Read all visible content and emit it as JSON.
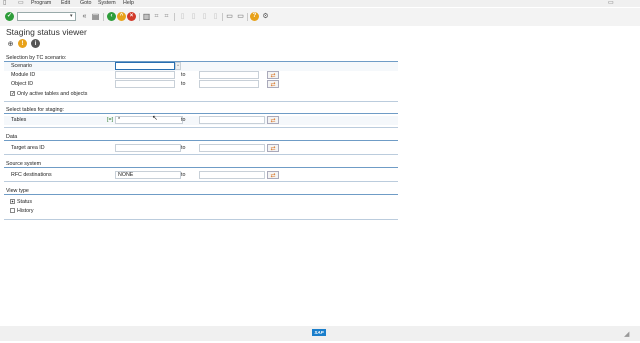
{
  "menu": {
    "items": [
      {
        "label": "Program",
        "name": "menu-program"
      },
      {
        "label": "Edit",
        "name": "menu-edit"
      },
      {
        "label": "Goto",
        "name": "menu-goto"
      },
      {
        "label": "System",
        "name": "menu-system"
      },
      {
        "label": "Help",
        "name": "menu-help"
      }
    ]
  },
  "title": "Staging status viewer",
  "frames": {
    "tc_scenario": {
      "title": "Selection by TC scenario:",
      "scenario_label": "Scenario",
      "module_label": "Module ID",
      "module_to": "to",
      "object_label": "Object ID",
      "object_to": "to",
      "only_active_label": "Only active tables and objects"
    },
    "tables_staging": {
      "title": "Select tables for staging:",
      "tables_label": "Tables",
      "tables_option": "[=]",
      "tables_value": "*",
      "tables_to": "to"
    },
    "data": {
      "title": "Data",
      "target_label": "Target area ID",
      "target_to": "to"
    },
    "source": {
      "title": "Source system",
      "rfc_label": "RFC destinations",
      "rfc_value": "NONE",
      "rfc_to": "to"
    },
    "view_type": {
      "title": "View type",
      "status_label": "Status",
      "history_label": "History",
      "selected": "Status"
    }
  },
  "colors": {
    "frame_line": "#6f9cc6",
    "toolbar_bg": "#f3f3f3",
    "accent_green": "#2e9d3a",
    "accent_orange": "#e8a21a",
    "accent_red": "#d23a2a"
  },
  "icons": {
    "enter": "check-icon",
    "save": "save-icon",
    "back": "back-icon",
    "exit": "exit-icon",
    "cancel": "cancel-icon",
    "print": "print-icon",
    "find": "find-icon",
    "help": "help-icon",
    "execute": "execute-icon",
    "variant": "variant-icon",
    "info": "info-icon",
    "multiple_selection": "multiple-selection-icon",
    "sap_logo": "sap-logo"
  },
  "status_bar": {
    "logo_text": "SAP"
  }
}
